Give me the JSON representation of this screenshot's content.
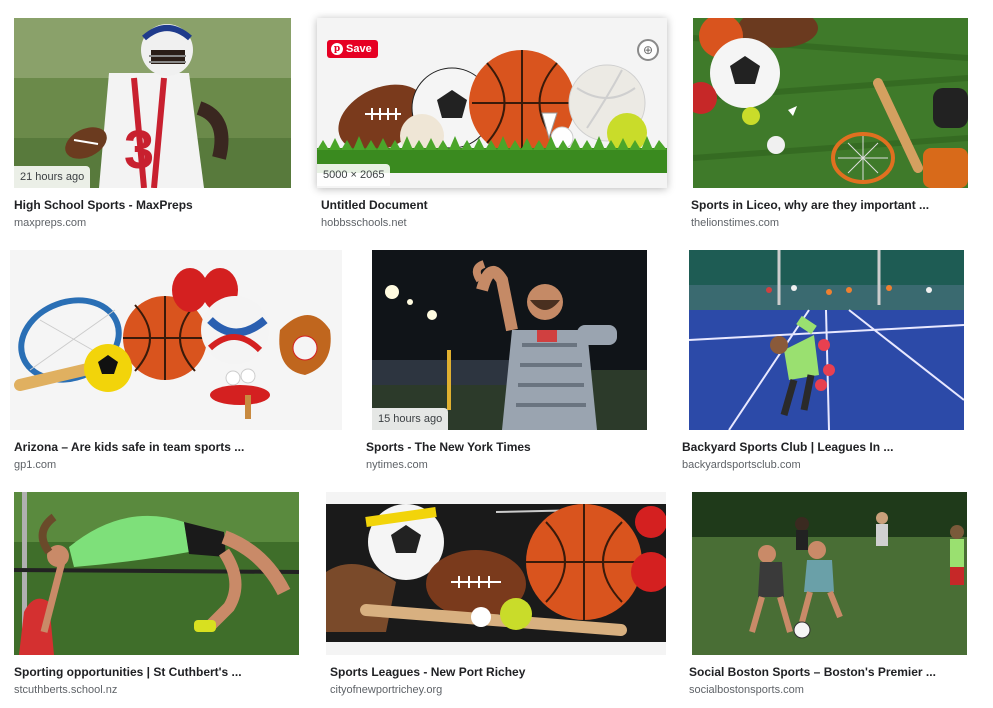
{
  "results": [
    {
      "title": "High School Sports - MaxPreps",
      "source": "maxpreps.com",
      "badge": "21 hours ago"
    },
    {
      "title": "Untitled Document",
      "source": "hobbsschools.net",
      "badge": "5000 × 2065",
      "save_label": "Save"
    },
    {
      "title": "Sports in Liceo, why are they important ...",
      "source": "thelionstimes.com"
    },
    {
      "title": "Arizona – Are kids safe in team sports ...",
      "source": "gp1.com"
    },
    {
      "title": "Sports - The New York Times",
      "source": "nytimes.com",
      "badge": "15 hours ago"
    },
    {
      "title": "Backyard Sports Club | Leagues In ...",
      "source": "backyardsportsclub.com"
    },
    {
      "title": "Sporting opportunities | St Cuthbert's ...",
      "source": "stcuthberts.school.nz"
    },
    {
      "title": "Sports Leagues - New Port Richey",
      "source": "cityofnewportrichey.org"
    },
    {
      "title": "Social Boston Sports – Boston's Premier ...",
      "source": "socialbostonsports.com"
    }
  ]
}
